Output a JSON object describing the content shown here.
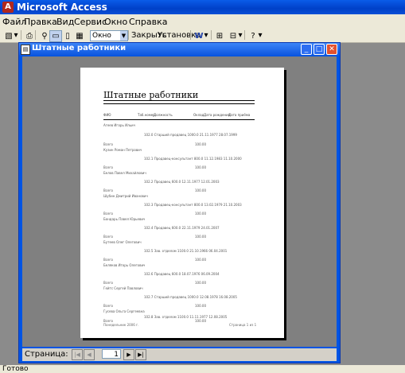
{
  "app": {
    "title": "Microsoft Access",
    "icon_letter": "A"
  },
  "menu": [
    "Файл",
    "Правка",
    "Вид",
    "Сервис",
    "Окно",
    "Справка"
  ],
  "toolbar": {
    "zoom_value": "Окно",
    "close_label": "Закрыть",
    "setup_label": "Установка",
    "icons": [
      "design-view-icon",
      "print-icon",
      "zoom-icon",
      "one-page-icon",
      "two-pages-icon",
      "multiple-pages-icon",
      "word-export-icon",
      "database-window-icon",
      "new-object-icon",
      "help-icon"
    ]
  },
  "document": {
    "title": "Штатные работники",
    "window_buttons": [
      "minimize",
      "maximize",
      "close"
    ]
  },
  "report": {
    "title": "Штатные работники",
    "headers": [
      "ФИО",
      "Таб.номер",
      "Должность",
      "Оклад",
      "Дата рождения",
      "Дата приёма"
    ],
    "rows": [
      {
        "name": "Агеев Игорь Ильич",
        "detail": "102.0   Старший продавец        1000.0    21.11.1977    28.07.1999"
      },
      {
        "name": "Кузин Роман Петрович",
        "detail": "102.1   Продавец-консультант   800.0     11.12.1983    11.10.2000"
      },
      {
        "name": "Белов Павел Михайлович",
        "detail": "102.2   Продавец              600.0     12.11.1977    12.01.2003"
      },
      {
        "name": "Шубин Дмитрий Иванович",
        "detail": "102.3   Продавец-консультант   800.0     13.02.1979    21.10.2003"
      },
      {
        "name": "Бондарь Павел Юрьевич",
        "detail": "102.4   Продавец              600.0     22.11.1979    24.01.2007"
      },
      {
        "name": "Бутеев Олег Олегович",
        "detail": "102.5   Зав. отделом          1100.0    21.10.1966    06.04.2001"
      },
      {
        "name": "Беляков Игорь Олегович",
        "detail": "102.6   Продавец              600.0     18.07.1976    06.09.2004"
      },
      {
        "name": "Гейтс Сергей Павлович",
        "detail": "102.7   Старший продавец       1000.0    12.08.1978    16.08.2005"
      },
      {
        "name": "Гусева Ольга Сергеевна",
        "detail": "102.8   Зав. отделом          1100.0    11.11.1977    12.08.2005"
      }
    ],
    "sum_label": "Всего",
    "sum_value": "100.00",
    "footer_left": "Понедельник 2006 г.",
    "footer_right": "Страница 1 из 1"
  },
  "nav": {
    "label": "Страница:",
    "page": "1"
  },
  "status": "Готово"
}
